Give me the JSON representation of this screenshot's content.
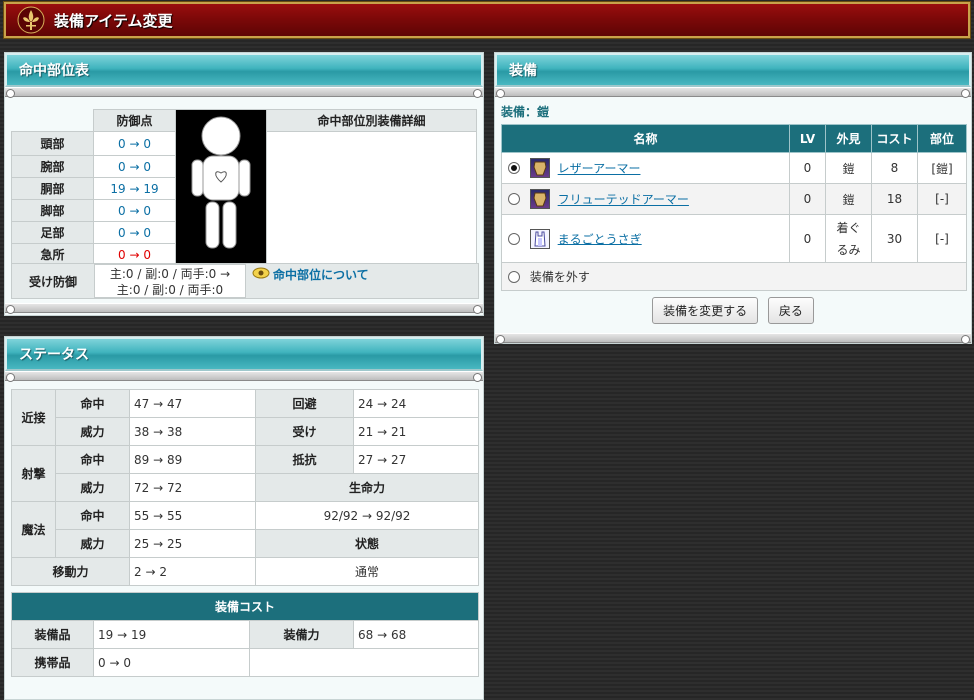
{
  "window": {
    "title": "装備アイテム変更"
  },
  "hit_panel": {
    "title": "命中部位表",
    "col_defense": "防御点",
    "col_detail": "命中部位別装備詳細",
    "rows": [
      {
        "part": "頭部",
        "value": "0 → 0",
        "color": "blue"
      },
      {
        "part": "腕部",
        "value": "0 → 0",
        "color": "blue"
      },
      {
        "part": "胴部",
        "value": "19 → 19",
        "color": "blue"
      },
      {
        "part": "脚部",
        "value": "0 → 0",
        "color": "blue"
      },
      {
        "part": "足部",
        "value": "0 → 0",
        "color": "blue"
      },
      {
        "part": "急所",
        "value": "0 → 0",
        "color": "red"
      }
    ],
    "receive_label": "受け防御",
    "receive_value": "主:0 / 副:0 / 両手:0 → 主:0 / 副:0 / 両手:0",
    "hit_link": "命中部位について"
  },
  "status_panel": {
    "title": "ステータス",
    "melee": "近接",
    "ranged": "射撃",
    "magic": "魔法",
    "hit": "命中",
    "power": "威力",
    "melee_hit": "47 → 47",
    "melee_power": "38 → 38",
    "ranged_hit": "89 → 89",
    "ranged_power": "72 → 72",
    "magic_hit": "55 → 55",
    "magic_power": "25 → 25",
    "evade_label": "回避",
    "evade_value": "24 → 24",
    "receive_label": "受け",
    "receive_value": "21 → 21",
    "resist_label": "抵抗",
    "resist_value": "27 → 27",
    "life_label": "生命力",
    "life_value": "92/92 → 92/92",
    "state_label": "状態",
    "state_value": "通常",
    "move_label": "移動力",
    "move_value": "2 → 2",
    "cost_title": "装備コスト",
    "equip_label": "装備品",
    "equip_value": "19 → 19",
    "equip_power_label": "装備力",
    "equip_power_value": "68 → 68",
    "carry_label": "携帯品",
    "carry_value": "0 → 0"
  },
  "equip_panel": {
    "title": "装備",
    "subtitle": "装備：鎧",
    "headers": [
      "名称",
      "LV",
      "外見",
      "コスト",
      "部位"
    ],
    "items": [
      {
        "name": "レザーアーマー",
        "lv": "0",
        "look": "鎧",
        "cost": "8",
        "slot": "[鎧]",
        "selected": true,
        "icon": "armor-icon"
      },
      {
        "name": "フリューテッドアーマー",
        "lv": "0",
        "look": "鎧",
        "cost": "18",
        "slot": "[-]",
        "selected": false,
        "icon": "armor-icon"
      },
      {
        "name": "まるごとうさぎ",
        "lv": "0",
        "look": "着ぐるみ",
        "cost": "30",
        "slot": "[-]",
        "selected": false,
        "icon": "costume-icon"
      }
    ],
    "remove_label": "装備を外す",
    "change_button": "装備を変更する",
    "back_button": "戻る"
  }
}
